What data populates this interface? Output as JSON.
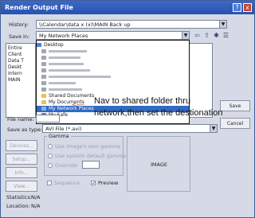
{
  "window": {
    "title": "Render Output File",
    "help_label": "?",
    "close_label": "x"
  },
  "history": {
    "label": "History:",
    "value": "\\\\Calendar\\data x (x)\\MAIN Back up"
  },
  "save_in": {
    "label": "Save in:",
    "value": "My Network Places"
  },
  "left_pane": {
    "items": [
      "Entire",
      "Client",
      "Data T",
      "Deskt",
      "Intern",
      "MAIN"
    ]
  },
  "dropdown": {
    "items": [
      {
        "label": "Desktop",
        "selected": false
      },
      {
        "label": "",
        "selected": false
      },
      {
        "label": "",
        "selected": false
      },
      {
        "label": "",
        "selected": false
      },
      {
        "label": "",
        "selected": false
      },
      {
        "label": "",
        "selected": false
      },
      {
        "label": "",
        "selected": false
      },
      {
        "label": "",
        "selected": false
      },
      {
        "label": "Shared Documents",
        "selected": false
      },
      {
        "label": "My Documents",
        "selected": false
      },
      {
        "label": "My Network Places",
        "selected": true
      },
      {
        "label": "My Safe",
        "selected": false
      }
    ]
  },
  "file_name": {
    "label": "File name:"
  },
  "save_as_type": {
    "label": "Save as type:",
    "value": "AVI File (*.avi)"
  },
  "buttons": {
    "devices": "Devices...",
    "setup": "Setup...",
    "info": "Info...",
    "view": "View...",
    "save": "Save",
    "cancel": "Cancel"
  },
  "gamma": {
    "title": "Gamma",
    "use_image_gamma": "Use image's own gamma",
    "use_system_gamma": "Use system default gamma",
    "override": "Override"
  },
  "sequence": {
    "label": "Sequence"
  },
  "preview": {
    "label": "Preview",
    "checked": true
  },
  "image_label": "IMAGE",
  "statistics": {
    "label": "Statistics:",
    "value": "N/A"
  },
  "location": {
    "label": "Location:",
    "value": "N/A"
  },
  "annotation": {
    "arrow": "<-----",
    "text": "Nav to shared folder thru network,then set the destionation"
  },
  "colors": {
    "titlebar": "#2852b0",
    "selection": "#316ac5",
    "annotation_arrow": "#d23a1a"
  }
}
